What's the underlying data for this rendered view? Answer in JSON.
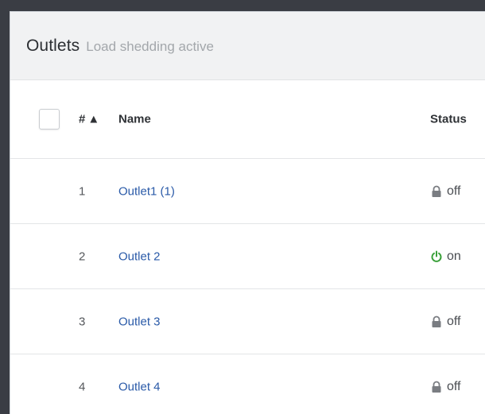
{
  "panel": {
    "title": "Outlets",
    "subtitle": "Load shedding active"
  },
  "table": {
    "headers": {
      "number": "#",
      "sort_indicator": "▲",
      "name": "Name",
      "status": "Status"
    },
    "rows": [
      {
        "number": "1",
        "name": "Outlet1 (1)",
        "status": "off",
        "status_icon": "lock-icon"
      },
      {
        "number": "2",
        "name": "Outlet 2",
        "status": "on",
        "status_icon": "power-icon"
      },
      {
        "number": "3",
        "name": "Outlet 3",
        "status": "off",
        "status_icon": "lock-icon"
      },
      {
        "number": "4",
        "name": "Outlet 4",
        "status": "off",
        "status_icon": "lock-icon"
      }
    ]
  },
  "colors": {
    "link": "#2a5aa8",
    "power_on": "#3aa03a",
    "lock": "#7a7d82",
    "header_bg": "#f1f2f3",
    "frame_bg": "#3a3d44"
  }
}
